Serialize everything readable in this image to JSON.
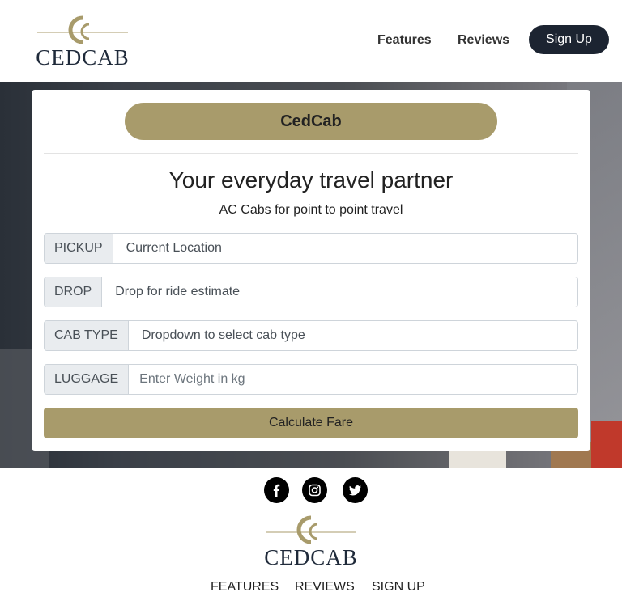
{
  "header": {
    "logo_text": "CEDCAB",
    "nav": [
      "Features",
      "Reviews"
    ],
    "signup_label": "Sign Up"
  },
  "form": {
    "brand": "CedCab",
    "tagline": "Your everyday travel partner",
    "subtagline": "AC Cabs for point to point travel",
    "fields": [
      {
        "label": "PICKUP",
        "value": "Current Location"
      },
      {
        "label": "DROP",
        "value": "Drop for ride estimate"
      },
      {
        "label": "CAB TYPE",
        "value": "Dropdown to select cab type"
      },
      {
        "label": "LUGGAGE",
        "placeholder": "Enter Weight in kg"
      }
    ],
    "calculate_label": "Calculate Fare"
  },
  "footer": {
    "social": [
      "facebook-icon",
      "instagram-icon",
      "twitter-icon"
    ],
    "logo_text": "CEDCAB",
    "links": [
      "FEATURES",
      "REVIEWS",
      "SIGN UP"
    ]
  },
  "colors": {
    "accent": "#a89b6b",
    "dark": "#1c2431"
  }
}
